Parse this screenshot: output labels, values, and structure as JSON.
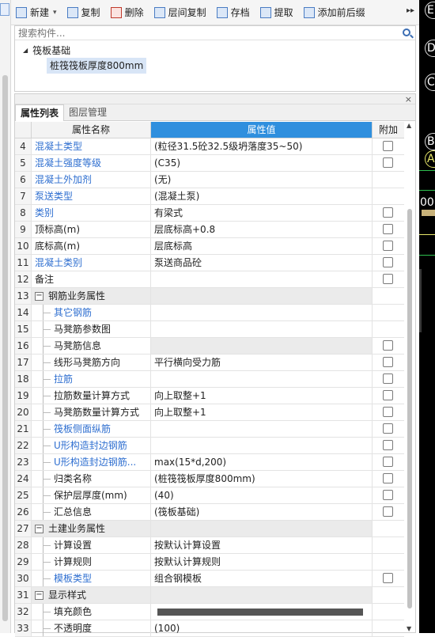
{
  "toolbar": {
    "new_label": "新建",
    "copy_label": "复制",
    "delete_label": "删除",
    "layer_copy_label": "层间复制",
    "save_label": "存档",
    "extract_label": "提取",
    "add_prefix_label": "添加前后缀",
    "more": "▸▸"
  },
  "tree": {
    "search_placeholder": "搜索构件...",
    "root_label": "筏板基础",
    "child_label": "桩筏筏板厚度800mm"
  },
  "props": {
    "tab_properties": "属性列表",
    "tab_layers": "图层管理",
    "col_name": "属性名称",
    "col_value": "属性值",
    "col_extra": "附加",
    "close": "×",
    "rows": [
      {
        "num": "4",
        "name": "混凝土类型",
        "value": "(粒径31.5砼32.5级坍落度35~50)"
      },
      {
        "num": "5",
        "name": "混凝土强度等级",
        "value": "(C35)"
      },
      {
        "num": "6",
        "name": "混凝土外加剂",
        "value": "(无)"
      },
      {
        "num": "7",
        "name": "泵送类型",
        "value": "(混凝土泵)"
      },
      {
        "num": "8",
        "name": "类别",
        "value": "有梁式"
      },
      {
        "num": "9",
        "name": "顶标高(m)",
        "value": "层底标高+0.8"
      },
      {
        "num": "10",
        "name": "底标高(m)",
        "value": "层底标高"
      },
      {
        "num": "11",
        "name": "混凝土类别",
        "value": "泵送商品砼"
      },
      {
        "num": "12",
        "name": "备注",
        "value": ""
      },
      {
        "num": "13",
        "name": "钢筋业务属性",
        "value": ""
      },
      {
        "num": "14",
        "name": "其它钢筋",
        "value": ""
      },
      {
        "num": "15",
        "name": "马凳筋参数图",
        "value": ""
      },
      {
        "num": "16",
        "name": "马凳筋信息",
        "value": ""
      },
      {
        "num": "17",
        "name": "线形马凳筋方向",
        "value": "平行横向受力筋"
      },
      {
        "num": "18",
        "name": "拉筋",
        "value": ""
      },
      {
        "num": "19",
        "name": "拉筋数量计算方式",
        "value": "向上取整+1"
      },
      {
        "num": "20",
        "name": "马凳筋数量计算方式",
        "value": "向上取整+1"
      },
      {
        "num": "21",
        "name": "筏板侧面纵筋",
        "value": ""
      },
      {
        "num": "22",
        "name": "U形构造封边钢筋",
        "value": ""
      },
      {
        "num": "23",
        "name": "U形构造封边钢筋...",
        "value": "max(15*d,200)"
      },
      {
        "num": "24",
        "name": "归类名称",
        "value": "(桩筏筏板厚度800mm)"
      },
      {
        "num": "25",
        "name": "保护层厚度(mm)",
        "value": "(40)"
      },
      {
        "num": "26",
        "name": "汇总信息",
        "value": "(筏板基础)"
      },
      {
        "num": "27",
        "name": "土建业务属性",
        "value": ""
      },
      {
        "num": "28",
        "name": "计算设置",
        "value": "按默认计算设置"
      },
      {
        "num": "29",
        "name": "计算规则",
        "value": "按默认计算规则"
      },
      {
        "num": "30",
        "name": "模板类型",
        "value": "组合钢模板"
      },
      {
        "num": "31",
        "name": "显示样式",
        "value": ""
      },
      {
        "num": "32",
        "name": "填充颜色",
        "value": ""
      },
      {
        "num": "33",
        "name": "不透明度",
        "value": "(100)"
      }
    ]
  },
  "cad": {
    "letters": [
      "E",
      "D",
      "C",
      "B",
      "A"
    ],
    "number": "00"
  },
  "colors": {
    "header_accent": "#2f8fde",
    "link_blue": "#2f6fd0",
    "fill_color_swatch": "#555555"
  }
}
